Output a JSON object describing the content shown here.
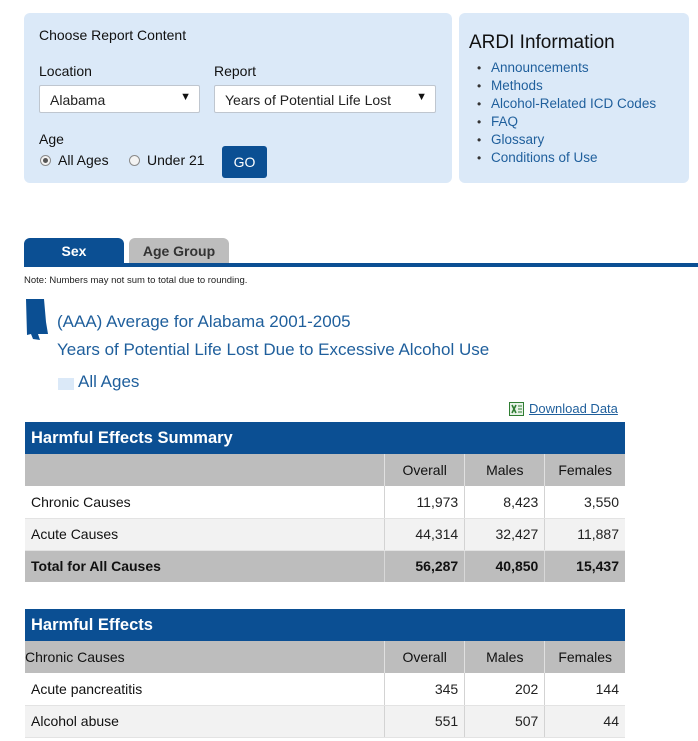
{
  "report_panel": {
    "title": "Choose Report Content",
    "location_label": "Location",
    "location_value": "Alabama",
    "report_label": "Report",
    "report_value": "Years of Potential Life Lost",
    "age_label": "Age",
    "age_options": [
      {
        "label": "All Ages",
        "checked": true
      },
      {
        "label": "Under 21",
        "checked": false
      }
    ],
    "go_label": "GO"
  },
  "ardi": {
    "title": "ARDI Information",
    "links": [
      "Announcements",
      "Methods",
      "Alcohol-Related ICD Codes",
      "FAQ",
      "Glossary",
      "Conditions of Use"
    ]
  },
  "tabs": [
    {
      "label": "Sex",
      "active": true
    },
    {
      "label": "Age Group",
      "active": false
    }
  ],
  "note": "Note: Numbers may not sum to total due to rounding.",
  "heading": {
    "line1": "(AAA) Average for Alabama 2001-2005",
    "line2": "Years of Potential Life Lost Due to Excessive Alcohol Use",
    "age_group": "All Ages"
  },
  "download_label": "Download Data",
  "summary_table": {
    "title": "Harmful Effects Summary",
    "columns": [
      "",
      "Overall",
      "Males",
      "Females"
    ],
    "rows": [
      [
        "Chronic Causes",
        "11,973",
        "8,423",
        "3,550"
      ],
      [
        "Acute Causes",
        "44,314",
        "32,427",
        "11,887"
      ]
    ],
    "total": [
      "Total for All Causes",
      "56,287",
      "40,850",
      "15,437"
    ]
  },
  "effects_table": {
    "title": "Harmful Effects",
    "columns": [
      "Chronic Causes",
      "Overall",
      "Males",
      "Females"
    ],
    "rows": [
      [
        "Acute pancreatitis",
        "345",
        "202",
        "144"
      ],
      [
        "Alcohol abuse",
        "551",
        "507",
        "44"
      ]
    ]
  },
  "colors": {
    "primary": "#0b4f93",
    "panel_bg": "#dbe9f8",
    "link": "#1f5f9c",
    "header_gray": "#bdbdbd"
  }
}
